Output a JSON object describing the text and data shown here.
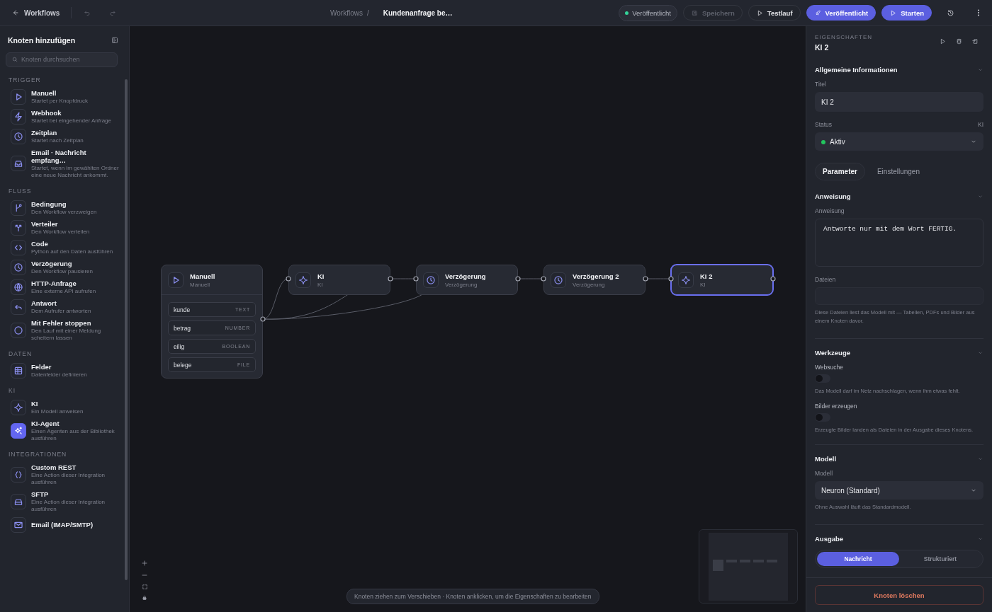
{
  "topbar": {
    "back": "Workflows",
    "breadcrumb": {
      "parent": "Workflows",
      "separator": "/",
      "current": "Kundenanfrage be…"
    },
    "status": {
      "label": "Veröffentlicht",
      "color": "#34d399"
    },
    "actions": [
      {
        "kind": "save",
        "label": "Speichern",
        "disabled": true
      },
      {
        "kind": "test",
        "label": "Testlauf",
        "disabled": false
      },
      {
        "kind": "publish",
        "label": "Veröffentlicht",
        "disabled": false
      },
      {
        "kind": "start",
        "label": "Starten",
        "disabled": false
      }
    ]
  },
  "sidebar": {
    "title": "Knoten hinzufügen",
    "search": {
      "placeholder": "Knoten durchsuchen"
    },
    "groups": [
      {
        "label": "TRIGGER",
        "items": [
          {
            "kind": "manual",
            "title": "Manuell",
            "subtitle": "Startet per Knopfdruck"
          },
          {
            "kind": "webhook",
            "title": "Webhook",
            "subtitle": "Startet bei eingehender Anfrage"
          },
          {
            "kind": "schedule",
            "title": "Zeitplan",
            "subtitle": "Startet nach Zeitplan"
          },
          {
            "kind": "email",
            "title": "Email · Nachricht empfang…",
            "subtitle": "Startet, wenn im gewählten Ordner eine neue Nachricht ankommt."
          }
        ]
      },
      {
        "label": "FLUSS",
        "items": [
          {
            "kind": "condition",
            "title": "Bedingung",
            "subtitle": "Den Workflow verzweigen"
          },
          {
            "kind": "splitter",
            "title": "Verteiler",
            "subtitle": "Den Workflow verteilen"
          },
          {
            "kind": "code",
            "title": "Code",
            "subtitle": "Python auf den Daten ausführen"
          },
          {
            "kind": "delay",
            "title": "Verzögerung",
            "subtitle": "Den Workflow pausieren"
          },
          {
            "kind": "http",
            "title": "HTTP-Anfrage",
            "subtitle": "Eine externe API aufrufen"
          },
          {
            "kind": "reply",
            "title": "Antwort",
            "subtitle": "Dem Aufrufer antworten"
          },
          {
            "kind": "stop",
            "title": "Mit Fehler stoppen",
            "subtitle": "Den Lauf mit einer Meldung scheitern lassen"
          }
        ]
      },
      {
        "label": "DATEN",
        "items": [
          {
            "kind": "fields",
            "title": "Felder",
            "subtitle": "Datenfelder definieren"
          }
        ]
      },
      {
        "label": "KI",
        "items": [
          {
            "kind": "ai",
            "title": "KI",
            "subtitle": "Ein Modell anweisen"
          },
          {
            "kind": "agent",
            "title": "KI-Agent",
            "subtitle": "Einen Agenten aus der Bibliothek ausführen"
          }
        ]
      },
      {
        "label": "INTEGRATIONEN",
        "items": [
          {
            "kind": "rest",
            "title": "Custom REST",
            "subtitle": "Eine Action dieser Integration ausführen"
          },
          {
            "kind": "sftp",
            "title": "SFTP",
            "subtitle": "Eine Action dieser Integration ausführen"
          },
          {
            "kind": "mail",
            "title": "Email (IMAP/SMTP)"
          }
        ]
      }
    ]
  },
  "canvas": {
    "nodes": [
      {
        "kind": "manual",
        "title": "Manuell",
        "subtitle": "Manuell",
        "selected": false,
        "fields": [
          {
            "name": "kunde",
            "type": "TEXT"
          },
          {
            "name": "betrag",
            "type": "NUMBER"
          },
          {
            "name": "eilig",
            "type": "BOOLEAN"
          },
          {
            "name": "belege",
            "type": "FILE"
          }
        ]
      },
      {
        "kind": "ai",
        "title": "KI",
        "subtitle": "KI",
        "selected": false
      },
      {
        "kind": "delay",
        "title": "Verzögerung",
        "subtitle": "Verzögerung",
        "selected": false
      },
      {
        "kind": "delay",
        "title": "Verzögerung 2",
        "subtitle": "Verzögerung",
        "selected": false
      },
      {
        "kind": "ai",
        "title": "KI 2",
        "subtitle": "KI",
        "selected": true
      }
    ],
    "hint": "Knoten ziehen zum Verschieben · Knoten anklicken, um die Eigenschaften zu bearbeiten"
  },
  "properties": {
    "eyebrow": "EIGENSCHAFTEN",
    "title": "KI 2",
    "general": {
      "heading": "Allgemeine Informationen",
      "expanded": true,
      "title_label": "Titel",
      "title_value": "KI 2",
      "status_label": "Status",
      "type_label": "KI",
      "status": {
        "value": "Aktiv",
        "color": "#22c55e"
      }
    },
    "tabs": [
      {
        "label": "Parameter",
        "selected": true
      },
      {
        "label": "Einstellungen",
        "selected": false
      }
    ],
    "instruction": {
      "heading": "Anweisung",
      "expanded": true,
      "label": "Anweisung",
      "value": "Antworte nur mit dem Wort FERTIG.",
      "files_label": "Dateien",
      "files_help": "Diese Dateien liest das Modell mit — Tabellen, PDFs und Bilder aus einem Knoten davor."
    },
    "tools": {
      "heading": "Werkzeuge",
      "expanded": true,
      "items": [
        {
          "label": "Websuche",
          "on": false,
          "help": "Das Modell darf im Netz nachschlagen, wenn ihm etwas fehlt."
        },
        {
          "label": "Bilder erzeugen",
          "on": false,
          "help": "Erzeugte Bilder landen als Dateien in der Ausgabe dieses Knotens."
        }
      ]
    },
    "model": {
      "heading": "Modell",
      "expanded": true,
      "label": "Modell",
      "value": "Neuron (Standard)",
      "help": "Ohne Auswahl läuft das Standardmodell."
    },
    "output": {
      "heading": "Ausgabe",
      "expanded": true,
      "options": [
        {
          "label": "Nachricht",
          "selected": true
        },
        {
          "label": "Strukturiert",
          "selected": false
        }
      ]
    },
    "delete_label": "Knoten löschen"
  }
}
